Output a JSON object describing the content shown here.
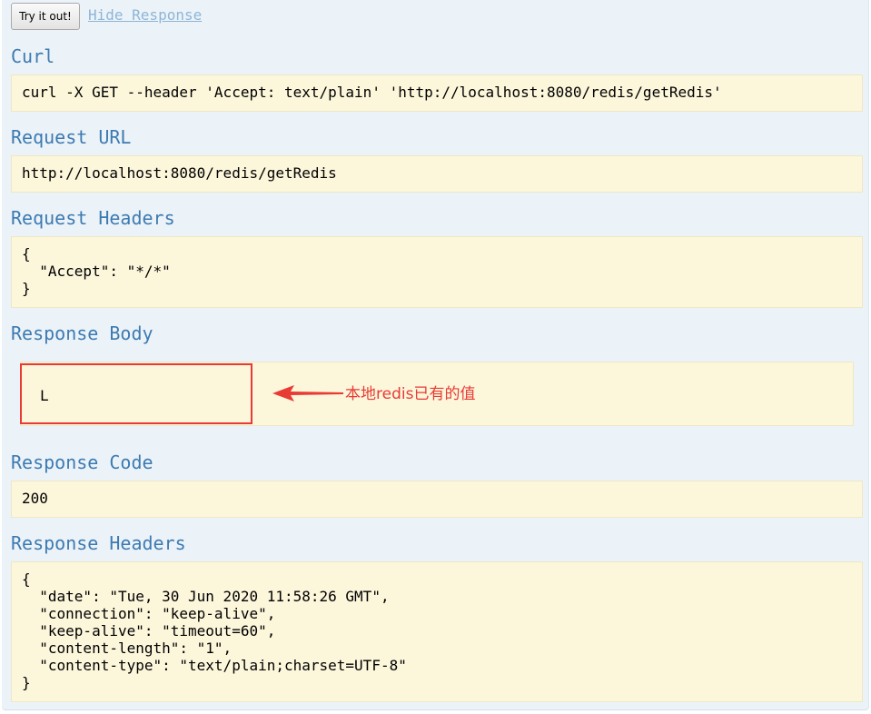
{
  "actions": {
    "try_label": "Try it out!",
    "hide_label": "Hide Response"
  },
  "curl": {
    "heading": "Curl",
    "command": "curl -X GET --header 'Accept: text/plain' 'http://localhost:8080/redis/getRedis'"
  },
  "request_url": {
    "heading": "Request URL",
    "value": "http://localhost:8080/redis/getRedis"
  },
  "request_headers": {
    "heading": "Request Headers",
    "body": "{\n  \"Accept\": \"*/*\"\n}"
  },
  "response_body": {
    "heading": "Response Body",
    "value": "L",
    "annotation": "本地redis已有的值"
  },
  "response_code": {
    "heading": "Response Code",
    "value": "200"
  },
  "response_headers": {
    "heading": "Response Headers",
    "body": "{\n  \"date\": \"Tue, 30 Jun 2020 11:58:26 GMT\",\n  \"connection\": \"keep-alive\",\n  \"keep-alive\": \"timeout=60\",\n  \"content-length\": \"1\",\n  \"content-type\": \"text/plain;charset=UTF-8\"\n}"
  },
  "colors": {
    "heading": "#3d7ab1",
    "box_background": "#fcf6db",
    "annotation_red": "#e83b35",
    "panel_background": "#ebf3f9"
  }
}
